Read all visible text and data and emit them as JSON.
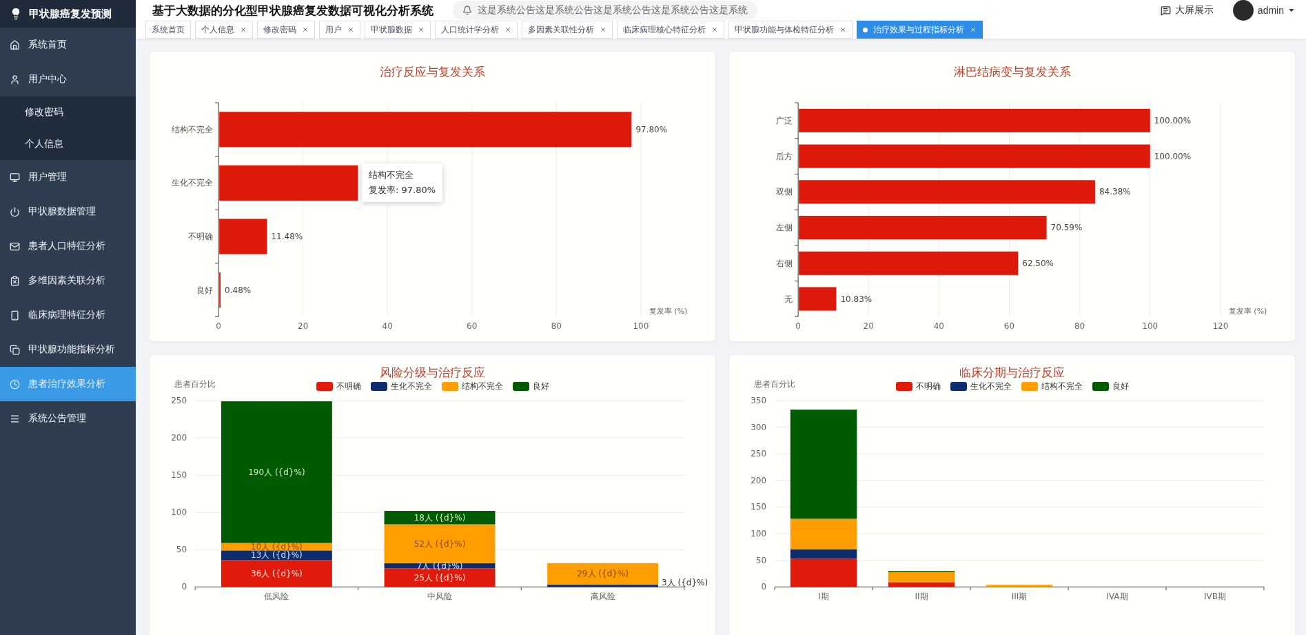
{
  "sidebar": {
    "brand": "甲状腺癌复发预测",
    "items": [
      {
        "label": "系统首页",
        "selected": false
      },
      {
        "label": "用户中心",
        "selected": false,
        "expanded": true,
        "children": [
          {
            "label": "修改密码",
            "selected": false
          },
          {
            "label": "个人信息",
            "selected": false
          }
        ]
      },
      {
        "label": "用户管理",
        "selected": false
      },
      {
        "label": "甲状腺数据管理",
        "selected": false
      },
      {
        "label": "患者人口特征分析",
        "selected": false
      },
      {
        "label": "多维因素关联分析",
        "selected": false
      },
      {
        "label": "临床病理特征分析",
        "selected": false
      },
      {
        "label": "甲状腺功能指标分析",
        "selected": false
      },
      {
        "label": "患者治疗效果分析",
        "selected": true
      },
      {
        "label": "系统公告管理",
        "selected": false
      }
    ]
  },
  "header": {
    "title": "基于大数据的分化型甲状腺癌复发数据可视化分析系统",
    "notice": "这是系统公告这是系统公告这是系统公告这是系统公告这是系统",
    "screen_button": "大屏展示",
    "user": "admin"
  },
  "tabs": [
    {
      "label": "系统首页",
      "selected": false,
      "closable": false
    },
    {
      "label": "个人信息",
      "selected": false,
      "closable": true
    },
    {
      "label": "修改密码",
      "selected": false,
      "closable": true
    },
    {
      "label": "用户",
      "selected": false,
      "closable": true
    },
    {
      "label": "甲状腺数据",
      "selected": false,
      "closable": true
    },
    {
      "label": "人口统计学分析",
      "selected": false,
      "closable": true
    },
    {
      "label": "多因素关联性分析",
      "selected": false,
      "closable": true
    },
    {
      "label": "临床病理核心特征分析",
      "selected": false,
      "closable": true
    },
    {
      "label": "甲状腺功能与体检特征分析",
      "selected": false,
      "closable": true
    },
    {
      "label": "治疗效果与过程指标分析",
      "selected": true,
      "closable": true
    }
  ],
  "panels": [
    {
      "title": "治疗反应与复发关系",
      "tooltip": {
        "title": "结构不完全",
        "text": "复发率: 97.80%"
      },
      "chart_data": {
        "type": "bar",
        "orientation": "horizontal",
        "grid": true,
        "xlabel": "复发率 (%)",
        "categories": [
          "结构不完全",
          "生化不完全",
          "不明确",
          "良好"
        ],
        "values": [
          97.8,
          33,
          11.48,
          0.48
        ],
        "xlim": [
          0,
          100
        ],
        "xticks": [
          0,
          20,
          40,
          60,
          80,
          100
        ],
        "value_labels": [
          "97.80%",
          null,
          "11.48%",
          "0.48%"
        ]
      }
    },
    {
      "title": "淋巴结病变与复发关系",
      "chart_data": {
        "type": "bar",
        "orientation": "horizontal",
        "grid": true,
        "xlabel": "复发率 (%)",
        "categories": [
          "广泛",
          "后方",
          "双侧",
          "左侧",
          "右侧",
          "无"
        ],
        "values": [
          100,
          100,
          84.38,
          70.59,
          62.5,
          10.83
        ],
        "xlim": [
          0,
          120
        ],
        "xticks": [
          0,
          20,
          40,
          60,
          80,
          100,
          120
        ],
        "value_labels": [
          "100.00%",
          "100.00%",
          "84.38%",
          "70.59%",
          "62.50%",
          "10.83%"
        ]
      }
    },
    {
      "title": "风险分级与治疗反应",
      "chart_data": {
        "type": "bar",
        "orientation": "vertical",
        "grid": true,
        "stacked": true,
        "ylabel": "患者百分比",
        "categories": [
          "低风险",
          "中风险",
          "高风险"
        ],
        "series": [
          {
            "name": "不明确",
            "color": "#e01b0c",
            "values": [
              36,
              25,
              0
            ]
          },
          {
            "name": "生化不完全",
            "color": "#0d2d6e",
            "values": [
              13,
              7,
              3
            ]
          },
          {
            "name": "结构不完全",
            "color": "#ff9e00",
            "values": [
              10,
              52,
              29
            ]
          },
          {
            "name": "良好",
            "color": "#005a00",
            "values": [
              190,
              18,
              0
            ]
          }
        ],
        "ylim": [
          0,
          250
        ],
        "yticks": [
          0,
          50,
          100,
          150,
          200,
          250
        ],
        "value_labels": [
          [
            "36人 ({d}%)",
            "25人 ({d}%)",
            null
          ],
          [
            "13人 ({d}%)",
            "7人 ({d}%)",
            "3人 ({d}%)"
          ],
          [
            "10人 ({d}%)",
            "52人 ({d}%)",
            "29人 ({d}%)"
          ],
          [
            "190人 ({d}%)",
            "18人 ({d}%)",
            null
          ]
        ]
      }
    },
    {
      "title": "临床分期与治疗反应",
      "chart_data": {
        "type": "bar",
        "orientation": "vertical",
        "grid": true,
        "stacked": true,
        "ylabel": "患者百分比",
        "categories": [
          "I期",
          "II期",
          "III期",
          "IVA期",
          "IVB期"
        ],
        "series": [
          {
            "name": "不明确",
            "color": "#e01b0c",
            "values": [
              53,
              9,
              0,
              0,
              0
            ]
          },
          {
            "name": "生化不完全",
            "color": "#0d2d6e",
            "values": [
              18,
              null,
              0,
              0,
              0
            ]
          },
          {
            "name": "结构不完全",
            "color": "#ff9e00",
            "values": [
              57,
              19,
              4,
              null,
              null
            ]
          },
          {
            "name": "良好",
            "color": "#005a00",
            "values": [
              205,
              2,
              0,
              0,
              0
            ]
          }
        ],
        "ylim": [
          0,
          350
        ],
        "yticks": [
          0,
          50,
          100,
          150,
          200,
          250,
          300,
          350
        ]
      }
    }
  ]
}
